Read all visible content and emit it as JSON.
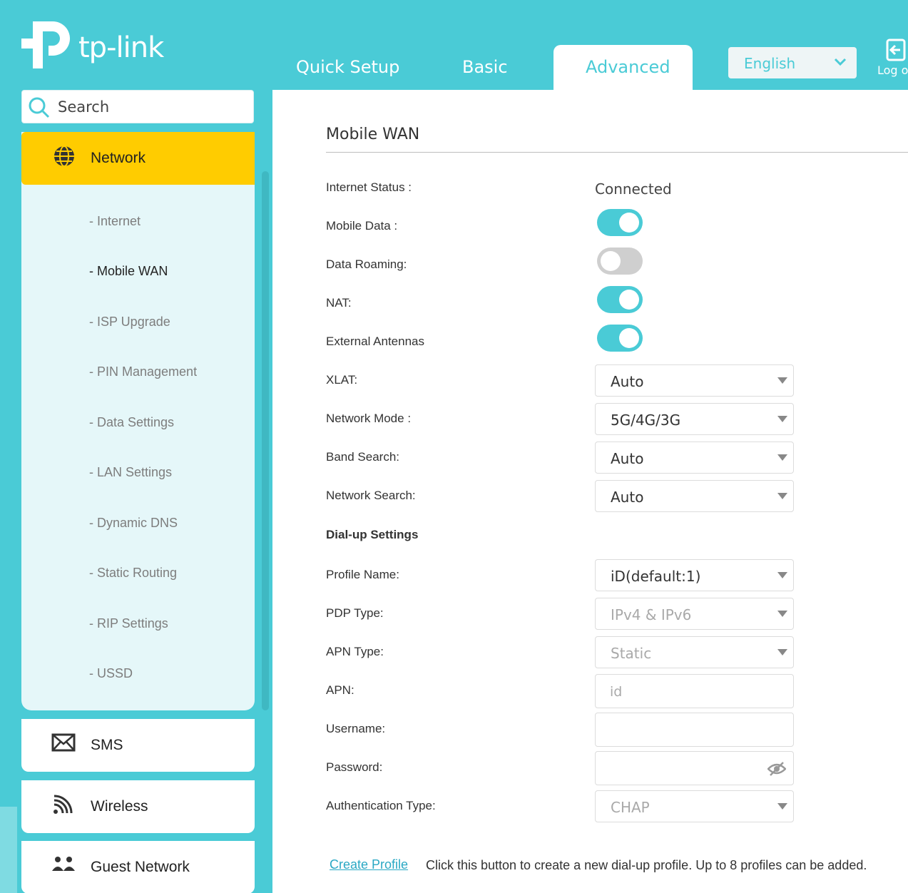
{
  "header": {
    "brand": "tp-link",
    "tabs": [
      {
        "label": "Quick Setup"
      },
      {
        "label": "Basic"
      },
      {
        "label": "Advanced"
      }
    ],
    "language": "English",
    "logout_label": "Log out",
    "accent_color": "#4acbd6"
  },
  "sidebar": {
    "search_placeholder": "Search",
    "network": {
      "label": "Network",
      "items": [
        {
          "label": "- Internet"
        },
        {
          "label": "- Mobile WAN"
        },
        {
          "label": "- ISP Upgrade"
        },
        {
          "label": "- PIN Management"
        },
        {
          "label": "- Data Settings"
        },
        {
          "label": "- LAN Settings"
        },
        {
          "label": "- Dynamic DNS"
        },
        {
          "label": "- Static Routing"
        },
        {
          "label": "- RIP Settings"
        },
        {
          "label": "- USSD"
        }
      ]
    },
    "sms": {
      "label": "SMS"
    },
    "wireless": {
      "label": "Wireless"
    },
    "guest": {
      "label": "Guest Network"
    }
  },
  "main": {
    "title": "Mobile WAN",
    "internet_status": {
      "label": "Internet Status :",
      "value": "Connected"
    },
    "mobile_data": {
      "label": "Mobile Data :",
      "on": true
    },
    "data_roaming": {
      "label": "Data Roaming:",
      "on": false
    },
    "nat": {
      "label": "NAT:",
      "on": true
    },
    "external_antennas": {
      "label": "External Antennas",
      "on": true
    },
    "xlat": {
      "label": "XLAT:",
      "value": "Auto"
    },
    "network_mode": {
      "label": "Network Mode :",
      "value": "5G/4G/3G"
    },
    "band_search": {
      "label": "Band Search:",
      "value": "Auto"
    },
    "network_search": {
      "label": "Network Search:",
      "value": "Auto"
    },
    "dialup_title": "Dial-up Settings",
    "profile_name": {
      "label": "Profile Name:",
      "value": "iD(default:1)"
    },
    "pdp_type": {
      "label": "PDP Type:",
      "value": "IPv4 & IPv6"
    },
    "apn_type": {
      "label": "APN Type:",
      "value": "Static"
    },
    "apn": {
      "label": "APN:",
      "placeholder": "id"
    },
    "username": {
      "label": "Username:",
      "value": ""
    },
    "password": {
      "label": "Password:",
      "value": ""
    },
    "auth_type": {
      "label": "Authentication Type:",
      "value": "CHAP"
    },
    "create_profile": {
      "label": "Create Profile",
      "hint": "Click this button to create a new dial-up profile. Up to 8 profiles can be added."
    }
  }
}
